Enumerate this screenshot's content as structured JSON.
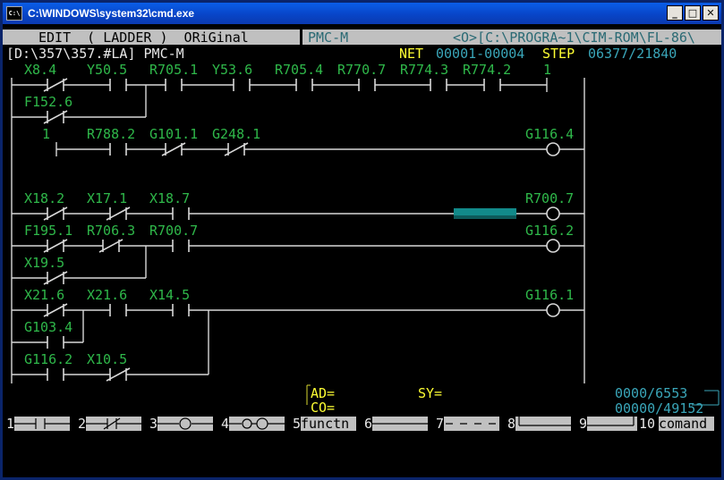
{
  "window": {
    "title": "C:\\WINDOWS\\system32\\cmd.exe",
    "icon": "cmd-icon"
  },
  "header": {
    "mode": "EDIT  ( LADDER )  ORiGinal",
    "pmc": "PMC-M",
    "path": "<O>[C:\\PROGRA~1\\CIM-ROM\\FL-86\\"
  },
  "status": {
    "file": "[D:\\357\\357.#LA] PMC-M",
    "net_label": "NET",
    "net_value": "00001-00004",
    "step_label": "STEP",
    "step_value": "06377/21840"
  },
  "ladder": {
    "rung1": {
      "contacts": [
        "X8.4",
        "Y50.5",
        "R705.1",
        "Y53.6",
        "R705.4",
        "R770.7",
        "R774.3",
        "R774.2"
      ],
      "coil": "1",
      "branch": "F152.6"
    },
    "rung2": {
      "left": "1",
      "contacts": [
        "R788.2",
        "G101.1",
        "G248.1"
      ],
      "coil": "G116.4"
    },
    "rung3": {
      "contacts": [
        "X18.2",
        "X17.1",
        "X18.7"
      ],
      "coil": "R700.7"
    },
    "rung4": {
      "contacts": [
        "F195.1",
        "R706.3",
        "R700.7"
      ],
      "coil": "G116.2",
      "branch": "X19.5"
    },
    "rung5": {
      "contacts": [
        "X21.6",
        "X21.6",
        "X14.5"
      ],
      "coil": "G116.1",
      "branch": "G103.4"
    },
    "rung6": {
      "contacts": [
        "G116.2",
        "X10.5"
      ]
    }
  },
  "footer": {
    "ad_label": "AD=",
    "co_label": "CO=",
    "sy_label": "SY=",
    "counter1": "0000/6553",
    "counter2": "00000/49152"
  },
  "fkeys": [
    {
      "num": "1",
      "kind": "no-contact"
    },
    {
      "num": "2",
      "kind": "nc-contact"
    },
    {
      "num": "3",
      "kind": "coil"
    },
    {
      "num": "4",
      "kind": "double-coil"
    },
    {
      "num": "5",
      "label": "functn"
    },
    {
      "num": "6",
      "kind": "horizontal-line"
    },
    {
      "num": "7",
      "kind": "dashed-line"
    },
    {
      "num": "8",
      "kind": "left-branch"
    },
    {
      "num": "9",
      "kind": "right-branch"
    },
    {
      "num": "10",
      "label": "comand"
    }
  ],
  "colors": {
    "green": "#2fb84a",
    "cyan": "#3aa6b9",
    "yellow": "#ffff33",
    "white": "#e8e8e8",
    "header_bg": "#c0c0c0",
    "cursor": "#128a8a"
  }
}
